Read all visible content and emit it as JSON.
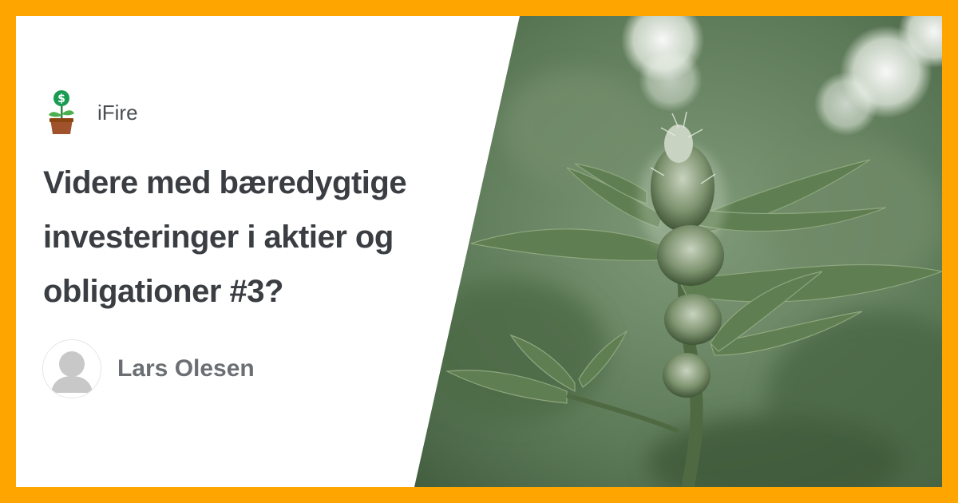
{
  "brand": {
    "name": "iFire",
    "icon": "money-plant-icon"
  },
  "article": {
    "title": "Videre med bæredygtige investeringer i aktier og obligationer #3?"
  },
  "author": {
    "name": "Lars Olesen",
    "avatar_icon": "default-avatar-icon"
  },
  "colors": {
    "frame": "#FFA500",
    "title_text": "#3a3d42",
    "brand_text": "#4a4d52",
    "author_text": "#6b6e72"
  },
  "photo": {
    "subject": "cannabis-plant-photo"
  }
}
